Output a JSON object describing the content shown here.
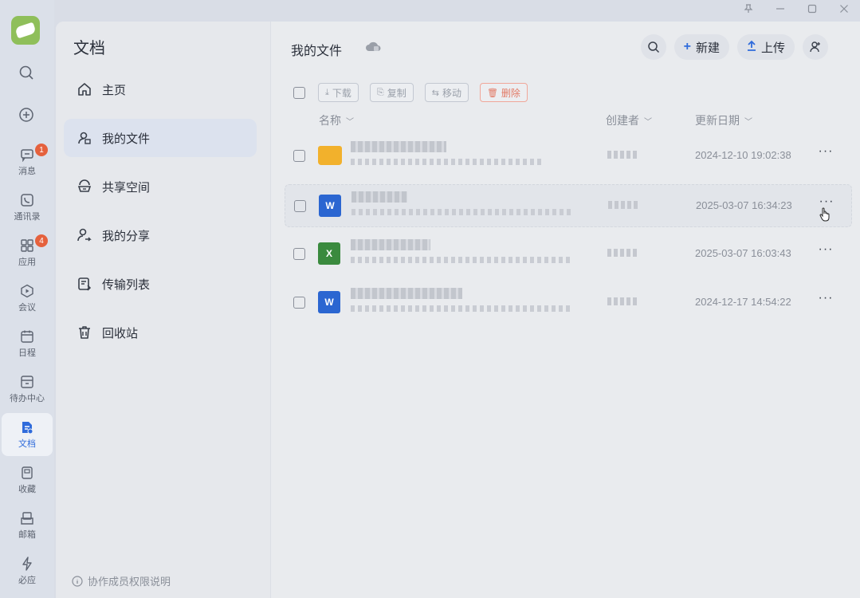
{
  "window": {
    "controls": [
      "pin",
      "minimize",
      "maximize",
      "close"
    ]
  },
  "rail": {
    "logo": "app-logo",
    "items": [
      {
        "key": "messages",
        "label": "消息",
        "icon": "message-icon",
        "badge": "1"
      },
      {
        "key": "contacts",
        "label": "通讯录",
        "icon": "contacts-icon",
        "badge": ""
      },
      {
        "key": "apps",
        "label": "应用",
        "icon": "apps-icon",
        "badge": "4"
      },
      {
        "key": "meeting",
        "label": "会议",
        "icon": "meeting-icon",
        "badge": ""
      },
      {
        "key": "calendar",
        "label": "日程",
        "icon": "calendar-icon",
        "badge": ""
      },
      {
        "key": "todo",
        "label": "待办中心",
        "icon": "todo-icon",
        "badge": ""
      },
      {
        "key": "docs",
        "label": "文档",
        "icon": "docs-icon",
        "badge": "",
        "active": true
      },
      {
        "key": "favorites",
        "label": "收藏",
        "icon": "favorites-icon",
        "badge": ""
      },
      {
        "key": "mail",
        "label": "邮箱",
        "icon": "mail-icon",
        "badge": ""
      },
      {
        "key": "approval",
        "label": "必应",
        "icon": "lightning-icon",
        "badge": ""
      }
    ]
  },
  "nav": {
    "title": "文档",
    "items": [
      {
        "label": "主页",
        "icon": "home-icon"
      },
      {
        "label": "我的文件",
        "icon": "user-file-icon",
        "active": true
      },
      {
        "label": "共享空间",
        "icon": "shared-space-icon"
      },
      {
        "label": "我的分享",
        "icon": "share-icon"
      },
      {
        "label": "传输列表",
        "icon": "transfer-list-icon"
      },
      {
        "label": "回收站",
        "icon": "trash-icon"
      }
    ],
    "footer": "协作成员权限说明"
  },
  "content": {
    "title": "我的文件",
    "toolbar": {
      "new_label": "新建",
      "upload_label": "上传"
    },
    "actions": {
      "download": "下载",
      "copy": "复制",
      "move": "移动",
      "delete": "删除"
    },
    "columns": {
      "name": "名称",
      "creator": "创建者",
      "updated": "更新日期"
    },
    "files": [
      {
        "type": "folder",
        "date": "2024-12-10 19:02:38"
      },
      {
        "type": "word",
        "date": "2025-03-07 16:34:23",
        "hover": true
      },
      {
        "type": "excel",
        "date": "2025-03-07 16:03:43"
      },
      {
        "type": "word",
        "date": "2024-12-17 14:54:22"
      }
    ]
  },
  "colors": {
    "accent": "#2f6bdb",
    "badge": "#e5613d",
    "folder": "#f2b12c",
    "word": "#2b66d1",
    "excel": "#3a8a3e",
    "danger": "#e27a66"
  }
}
